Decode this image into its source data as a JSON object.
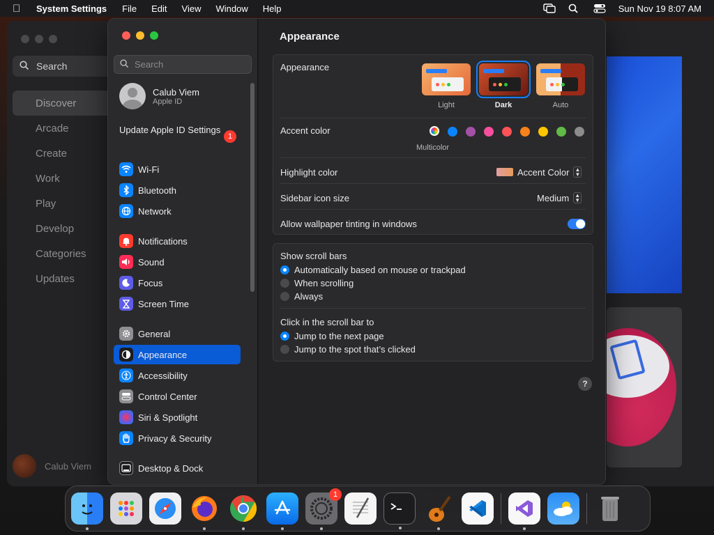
{
  "menubar": {
    "app_name": "System Settings",
    "items": [
      "File",
      "Edit",
      "View",
      "Window",
      "Help"
    ],
    "datetime": "Sun Nov 19  8:07 AM"
  },
  "background_app": {
    "search_placeholder": "Search",
    "nav": [
      "Discover",
      "Arcade",
      "Create",
      "Work",
      "Play",
      "Develop",
      "Categories",
      "Updates"
    ],
    "active_nav": "Discover",
    "user_name": "Calub Viem"
  },
  "sidebar": {
    "search_placeholder": "Search",
    "profile": {
      "name": "Calub Viem",
      "sub": "Apple ID"
    },
    "update": {
      "label": "Update Apple ID Settings",
      "badge": "1"
    },
    "items": [
      {
        "label": "Wi-Fi",
        "icon": "wifi-icon",
        "color": "#0a84ff"
      },
      {
        "label": "Bluetooth",
        "icon": "bluetooth-icon",
        "color": "#0a84ff"
      },
      {
        "label": "Network",
        "icon": "globe-icon",
        "color": "#0a84ff"
      },
      {
        "label": "Notifications",
        "icon": "bell-icon",
        "color": "#ff3b30"
      },
      {
        "label": "Sound",
        "icon": "speaker-icon",
        "color": "#ff2d55"
      },
      {
        "label": "Focus",
        "icon": "moon-icon",
        "color": "#5e5ce6"
      },
      {
        "label": "Screen Time",
        "icon": "hourglass-icon",
        "color": "#5e5ce6"
      },
      {
        "label": "General",
        "icon": "gear-icon",
        "color": "#8e8e93"
      },
      {
        "label": "Appearance",
        "icon": "appearance-icon",
        "color": "#1c1c1e"
      },
      {
        "label": "Accessibility",
        "icon": "accessibility-icon",
        "color": "#0a84ff"
      },
      {
        "label": "Control Center",
        "icon": "control-center-icon",
        "color": "#8e8e93"
      },
      {
        "label": "Siri & Spotlight",
        "icon": "siri-icon",
        "color": "#bf5af2"
      },
      {
        "label": "Privacy & Security",
        "icon": "hand-icon",
        "color": "#0a84ff"
      },
      {
        "label": "Desktop & Dock",
        "icon": "dock-icon",
        "color": "#1c1c1e"
      }
    ],
    "active": "Appearance"
  },
  "content": {
    "title": "Appearance",
    "appearance": {
      "label": "Appearance",
      "options": [
        "Light",
        "Dark",
        "Auto"
      ],
      "selected": "Dark"
    },
    "accent": {
      "label": "Accent color",
      "selected_caption": "Multicolor",
      "colors": [
        "#0a84ff",
        "#a550a7",
        "#f74f9e",
        "#ff5257",
        "#f7821b",
        "#ffc600",
        "#62ba46",
        "#8c8c8c"
      ]
    },
    "highlight": {
      "label": "Highlight color",
      "value": "Accent Color"
    },
    "sidebar_icon_size": {
      "label": "Sidebar icon size",
      "value": "Medium"
    },
    "wallpaper_tinting": {
      "label": "Allow wallpaper tinting in windows",
      "on": true
    },
    "scroll_bars": {
      "label": "Show scroll bars",
      "options": [
        "Automatically based on mouse or trackpad",
        "When scrolling",
        "Always"
      ],
      "selected": 0
    },
    "click_scroll": {
      "label": "Click in the scroll bar to",
      "options": [
        "Jump to the next page",
        "Jump to the spot that’s clicked"
      ],
      "selected": 0
    },
    "help": "?"
  },
  "dock": {
    "items": [
      "finder",
      "launchpad",
      "safari",
      "firefox",
      "chrome",
      "app-store",
      "system-settings",
      "textedit",
      "terminal",
      "garageband",
      "vscode"
    ],
    "settings_badge": "1",
    "right_items": [
      "visual-studio",
      "weather"
    ],
    "trash": "trash"
  }
}
